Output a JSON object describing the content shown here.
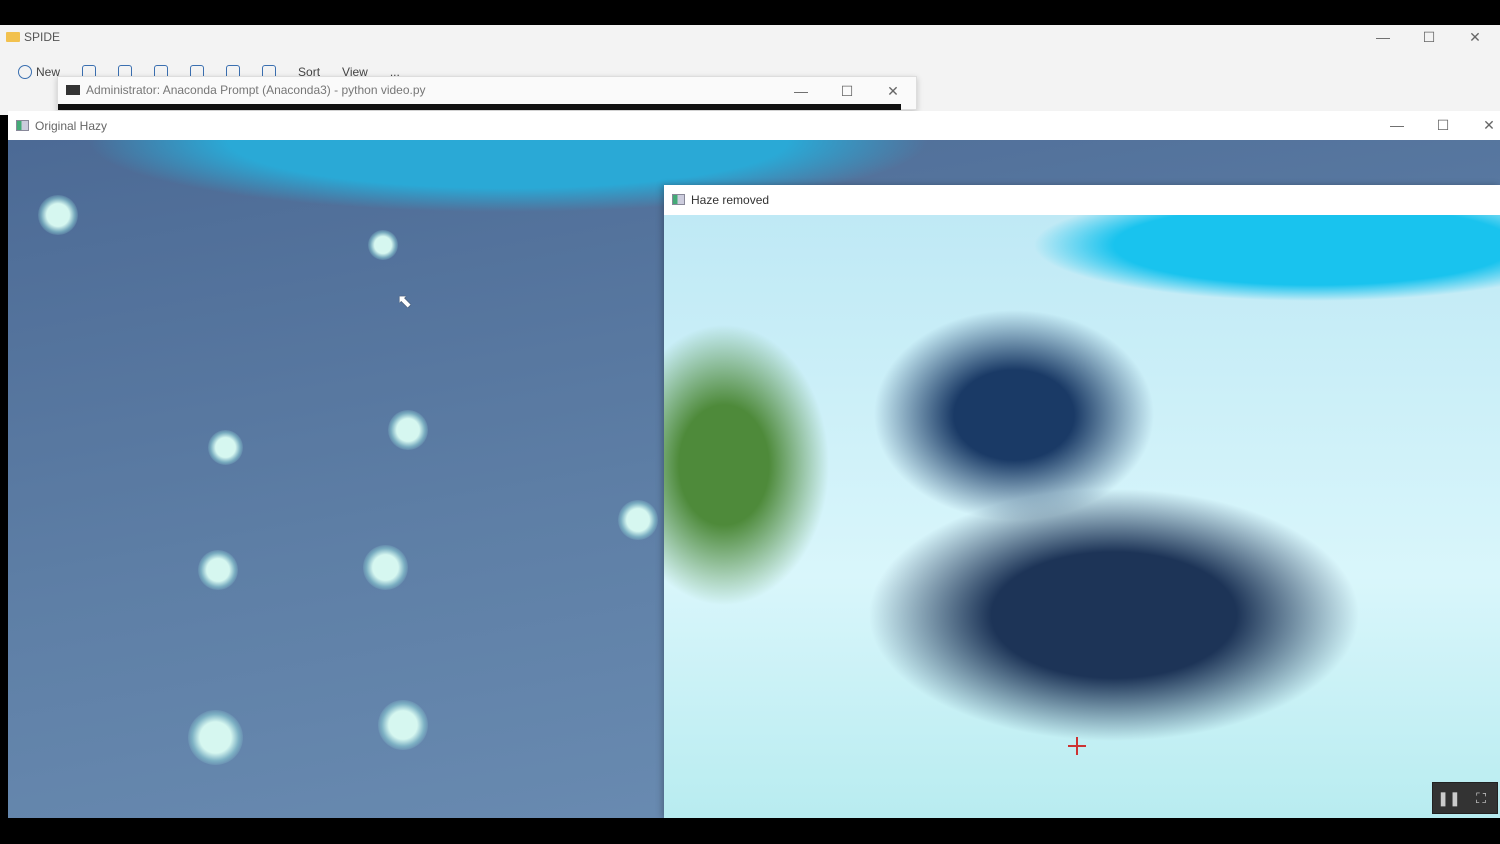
{
  "explorer": {
    "title": "SPIDE",
    "toolbar": {
      "new": "New",
      "sort": "Sort",
      "view": "View",
      "more": "..."
    }
  },
  "conda": {
    "title": "Administrator: Anaconda Prompt (Anaconda3) - python  video.py"
  },
  "windows": {
    "original": "Original Hazy",
    "dehazed": "Haze removed"
  },
  "icons": {
    "min": "—",
    "max": "☐",
    "close": "✕",
    "pause": "❚❚",
    "fullscreen": "⛶"
  }
}
